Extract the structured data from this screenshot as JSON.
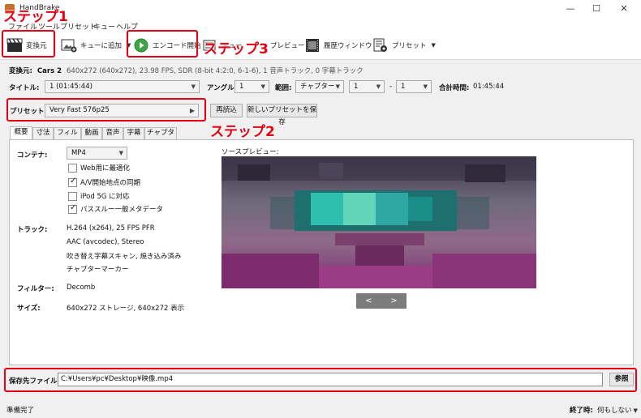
{
  "window": {
    "title": "HandBrake",
    "minimize": "—",
    "maximize": "☐",
    "close": "✕"
  },
  "menu": {
    "items": [
      "ファイル",
      "ツール",
      "プリセット",
      "キュー",
      "ヘルプ"
    ]
  },
  "toolbar": {
    "open_source": "変換元",
    "add_to_queue": "キューに追加",
    "start_encode": "エンコード開始",
    "queue": "キュー",
    "preview": "プレビュー",
    "activity_log": "履歴ウィンドウ",
    "presets": "プリセット"
  },
  "source": {
    "label": "変換元:",
    "name": "Cars 2",
    "details": "640x272 (640x272), 23.98 FPS, SDR (8-bit 4:2:0, 6-1-6), 1 音声トラック, 0 字幕トラック"
  },
  "title_row": {
    "title_label": "タイトル:",
    "title_value": "1 (01:45:44)",
    "angle_label": "アングル:",
    "angle_value": "1",
    "range_label": "範囲:",
    "range_type": "チャプター",
    "range_start": "1",
    "range_sep": "-",
    "range_end": "1",
    "duration_label": "合計時間:",
    "duration_value": "01:45:44"
  },
  "preset_row": {
    "label": "プリセット:",
    "value": "Very Fast 576p25",
    "reload": "再読込",
    "save_new": "新しいプリセットを保存"
  },
  "tabs": [
    "概要",
    "寸法",
    "フィルタ",
    "動画",
    "音声",
    "字幕",
    "チャプター"
  ],
  "summary": {
    "container_label": "コンテナ:",
    "container_value": "MP4",
    "options": [
      {
        "label": "Web用に最適化",
        "checked": false
      },
      {
        "label": "A/V開始地点の同期",
        "checked": true
      },
      {
        "label": "iPod 5G に対応",
        "checked": false
      },
      {
        "label": "パススルー一般メタデータ",
        "checked": true
      }
    ],
    "tracks_label": "トラック:",
    "tracks": [
      "H.264 (x264), 25 FPS PFR",
      "AAC (avcodec), Stereo",
      "吹き替え字幕スキャン, 焼き込み済み",
      "チャプターマーカー"
    ],
    "filters_label": "フィルター:",
    "filters_value": "Decomb",
    "size_label": "サイズ:",
    "size_value": "640x272 ストレージ, 640x272 表示"
  },
  "preview": {
    "label": "ソースプレビュー:",
    "prev": "<",
    "next": ">"
  },
  "save": {
    "label": "保存先ファイル:",
    "path": "C:¥Users¥pc¥Desktop¥映像.mp4",
    "browse": "参照"
  },
  "status": {
    "text": "準備完了",
    "when_done_label": "終了時:",
    "when_done_value": "何もしない"
  },
  "annotations": {
    "step1": "ステップ1",
    "step2": "ステップ2",
    "step3": "ステップ3"
  },
  "colors": {
    "annotation_red": "#e60012",
    "play_green": "#39a845"
  }
}
